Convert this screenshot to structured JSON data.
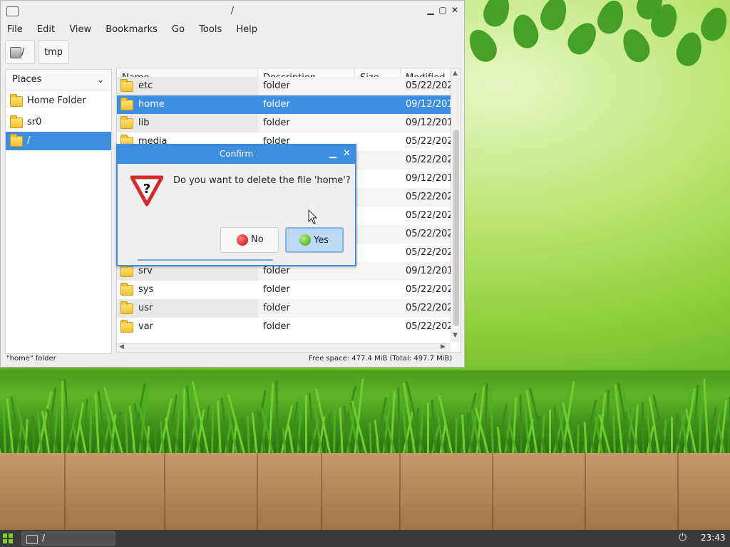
{
  "window": {
    "title": "/",
    "minimize": "▁",
    "maximize": "▢",
    "close": "✕"
  },
  "menubar": [
    "File",
    "Edit",
    "View",
    "Bookmarks",
    "Go",
    "Tools",
    "Help"
  ],
  "toolbar": {
    "path_root_label": "/",
    "path_tmp_label": "tmp"
  },
  "places": {
    "header": "Places",
    "items": [
      {
        "label": "Home Folder"
      },
      {
        "label": "sr0"
      },
      {
        "label": "/"
      }
    ]
  },
  "filelist": {
    "columns": [
      "Name",
      "Description",
      "Size",
      "Modified"
    ],
    "rows": [
      {
        "name": "etc",
        "desc": "folder",
        "size": "",
        "modified": "05/22/202"
      },
      {
        "name": "home",
        "desc": "folder",
        "size": "",
        "modified": "09/12/201"
      },
      {
        "name": "lib",
        "desc": "folder",
        "size": "",
        "modified": "09/12/201"
      },
      {
        "name": "media",
        "desc": "folder",
        "size": "",
        "modified": "05/22/202"
      },
      {
        "name": "mnt",
        "desc": "folder",
        "size": "",
        "modified": "05/22/202"
      },
      {
        "name": "",
        "desc": "",
        "size": "",
        "modified": "09/12/201"
      },
      {
        "name": "",
        "desc": "",
        "size": "",
        "modified": "05/22/202"
      },
      {
        "name": "",
        "desc": "",
        "size": "",
        "modified": "05/22/202"
      },
      {
        "name": "",
        "desc": "",
        "size": "",
        "modified": "05/22/202"
      },
      {
        "name": "",
        "desc": "",
        "size": "",
        "modified": "05/22/202"
      },
      {
        "name": "srv",
        "desc": "folder",
        "size": "",
        "modified": "09/12/201"
      },
      {
        "name": "sys",
        "desc": "folder",
        "size": "",
        "modified": "05/22/202"
      },
      {
        "name": "usr",
        "desc": "folder",
        "size": "",
        "modified": "05/22/202"
      },
      {
        "name": "var",
        "desc": "folder",
        "size": "",
        "modified": "05/22/202"
      }
    ]
  },
  "statusbar": {
    "left": "\"home\" folder",
    "right": "Free space: 477.4 MiB (Total: 497.7 MiB)"
  },
  "dialog": {
    "title": "Confirm",
    "message": "Do you want to delete the file 'home'?",
    "no_label": "No",
    "yes_label": "Yes",
    "minimize": "▁",
    "close": "✕"
  },
  "taskbar": {
    "task_label": "/",
    "clock": "23:43"
  },
  "colors": {
    "accent": "#3d8ee0",
    "folder": "#f1c232"
  }
}
